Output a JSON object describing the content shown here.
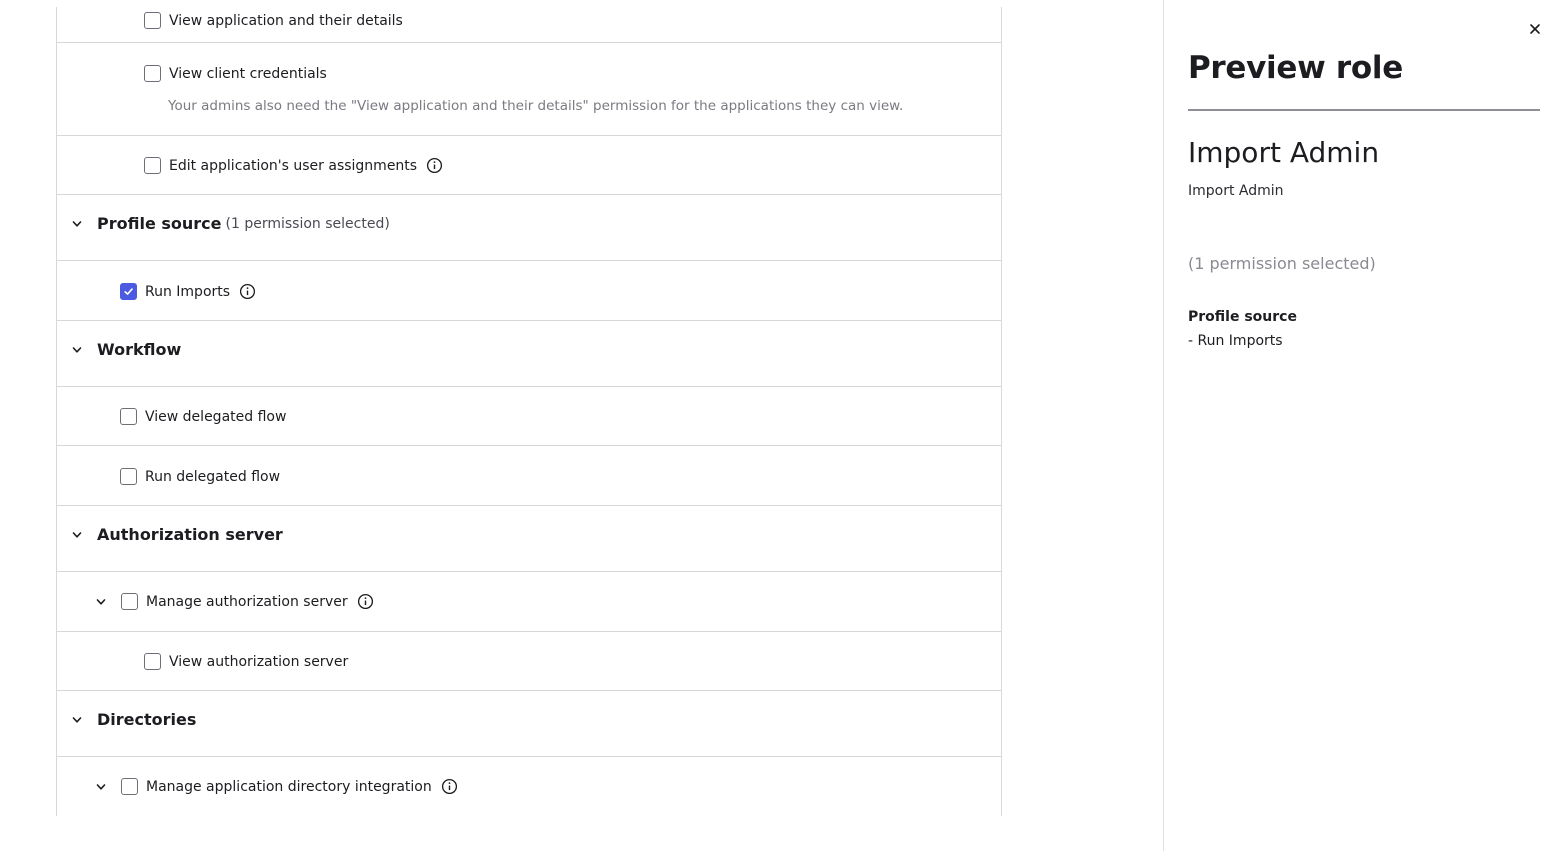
{
  "permissions": {
    "applications": {
      "view_apps": "View application and their details",
      "view_creds": "View client credentials",
      "view_creds_help": "Your admins also need the \"View application and their details\" permission for the applications they can view.",
      "edit_assignments": "Edit application's user assignments"
    },
    "profile_source": {
      "title": "Profile source",
      "count": "(1 permission selected)",
      "run_imports": "Run Imports"
    },
    "workflow": {
      "title": "Workflow",
      "view_flow": "View delegated flow",
      "run_flow": "Run delegated flow"
    },
    "authorization_server": {
      "title": "Authorization server",
      "manage": "Manage authorization server",
      "view": "View authorization server"
    },
    "directories": {
      "title": "Directories",
      "manage_integration": "Manage application directory integration"
    }
  },
  "preview": {
    "title": "Preview role",
    "role_name": "Import Admin",
    "role_description": "Import Admin",
    "permission_count": "(1 permission selected)",
    "group_name": "Profile source",
    "group_item": "- Run Imports"
  },
  "colors": {
    "checkbox_checked": "#4b5ae0",
    "border": "#d7d7dc",
    "muted_text": "#7a7a82"
  }
}
